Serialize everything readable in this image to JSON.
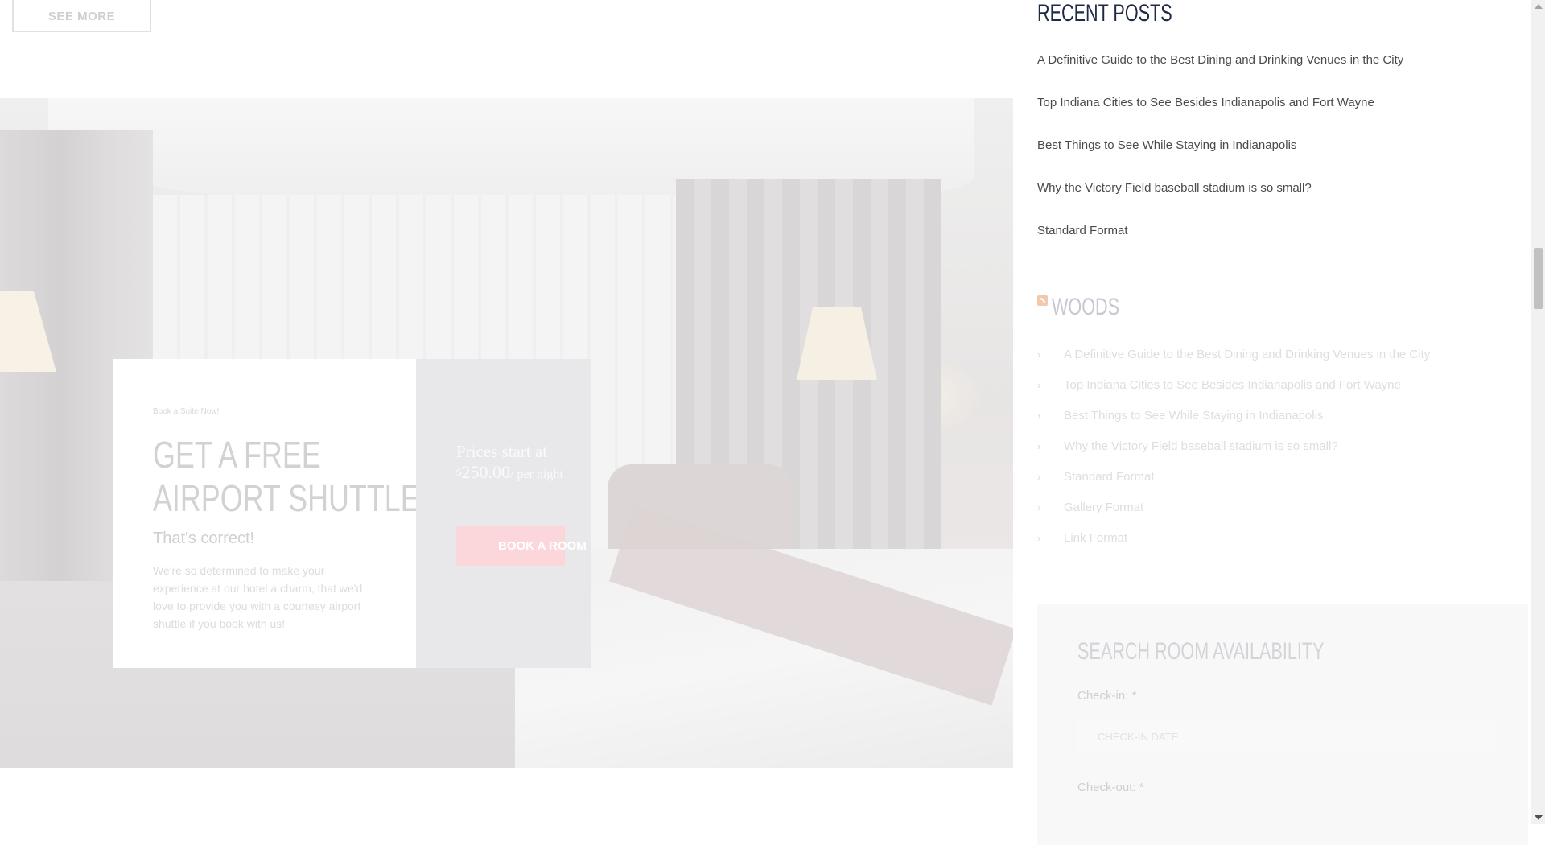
{
  "top": {
    "see_more_label": "SEE MORE"
  },
  "promo": {
    "kicker": "Book a Suite Now!",
    "title_line1": "GET A FREE",
    "title_line2": "AIRPORT SHUTTLE",
    "subtitle": "That's correct!",
    "body": "We're so determined to make your experience at our hotel a charm, that we'd love to provide you with a courtesy airport shuttle if you book with us!"
  },
  "pricing": {
    "prefix": "Prices start at",
    "currency": "$",
    "amount": "250.00",
    "unit": "/ per night",
    "button_label": "BOOK A ROOM"
  },
  "sidebar": {
    "recent_posts": {
      "title": "RECENT POSTS",
      "items": [
        "A Definitive Guide to the Best Dining and Drinking Venues in the City",
        "Top Indiana Cities to See Besides Indianapolis and Fort Wayne",
        "Best Things to See While Staying in Indianapolis",
        "Why the Victory Field baseball stadium is so small?",
        "Standard Format"
      ]
    },
    "woods": {
      "title": "WOODS",
      "items": [
        "A Definitive Guide to the Best Dining and Drinking Venues in the City",
        "Top Indiana Cities to See Besides Indianapolis and Fort Wayne",
        "Best Things to See While Staying in Indianapolis",
        "Why the Victory Field baseball stadium is so small?",
        "Standard Format",
        "Gallery Format",
        "Link Format"
      ]
    },
    "search": {
      "title": "SEARCH ROOM AVAILABILITY",
      "checkin_label": "Check-in: *",
      "checkin_placeholder": "CHECK-IN DATE",
      "checkout_label": "Check-out: *"
    }
  }
}
